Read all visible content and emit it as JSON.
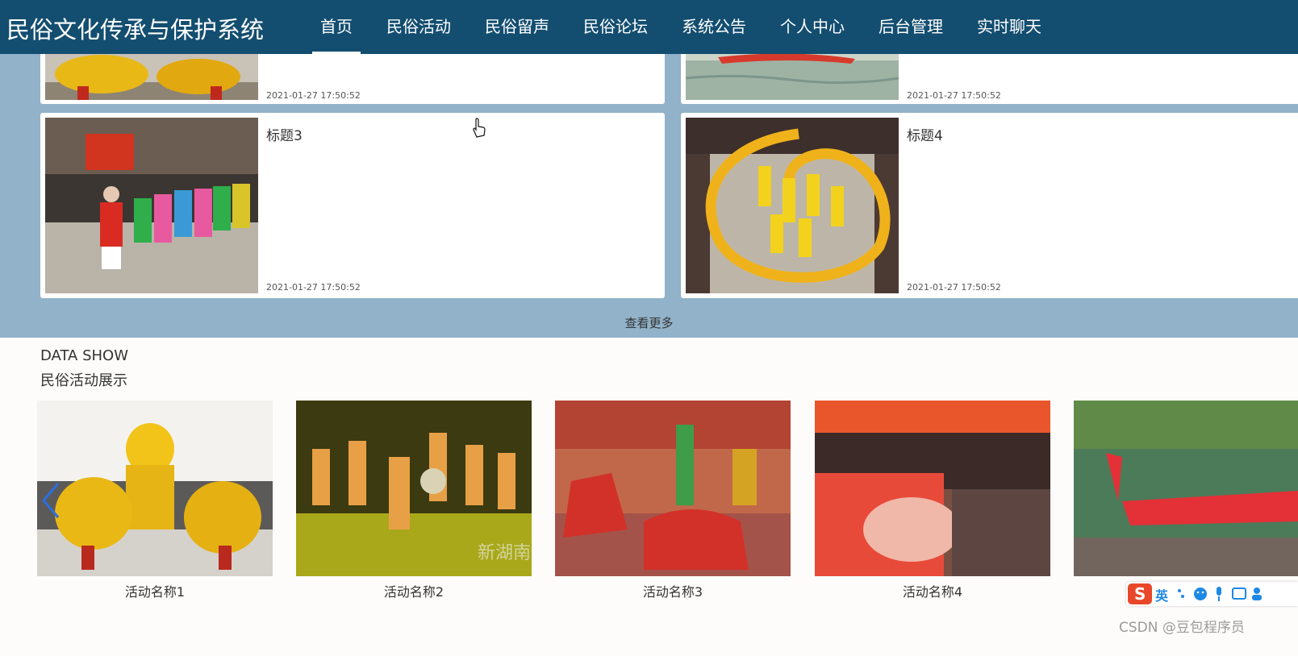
{
  "app_title": "民俗文化传承与保护系统",
  "nav": [
    {
      "label": "首页",
      "active": true
    },
    {
      "label": "民俗活动"
    },
    {
      "label": "民俗留声"
    },
    {
      "label": "民俗论坛"
    },
    {
      "label": "系统公告"
    },
    {
      "label": "个人中心"
    },
    {
      "label": "后台管理"
    },
    {
      "label": "实时聊天"
    }
  ],
  "news": [
    {
      "title": "",
      "time": "2021-01-27 17:50:52"
    },
    {
      "title": "",
      "time": "2021-01-27 17:50:52"
    },
    {
      "title": "标题3",
      "time": "2021-01-27 17:50:52"
    },
    {
      "title": "标题4",
      "time": "2021-01-27 17:50:52"
    }
  ],
  "more_label": "查看更多",
  "data_show": {
    "title": "DATA SHOW",
    "subtitle": "民俗活动展示",
    "items": [
      {
        "label": "活动名称1"
      },
      {
        "label": "活动名称2"
      },
      {
        "label": "活动名称3"
      },
      {
        "label": "活动名称4"
      },
      {
        "label": ""
      }
    ]
  },
  "ime": {
    "lang": "英"
  },
  "watermark": "CSDN @豆包程序员",
  "colors": {
    "nav_bg": "#134e70",
    "section_bg": "#91b2c8",
    "accent": "#1e88e5"
  }
}
